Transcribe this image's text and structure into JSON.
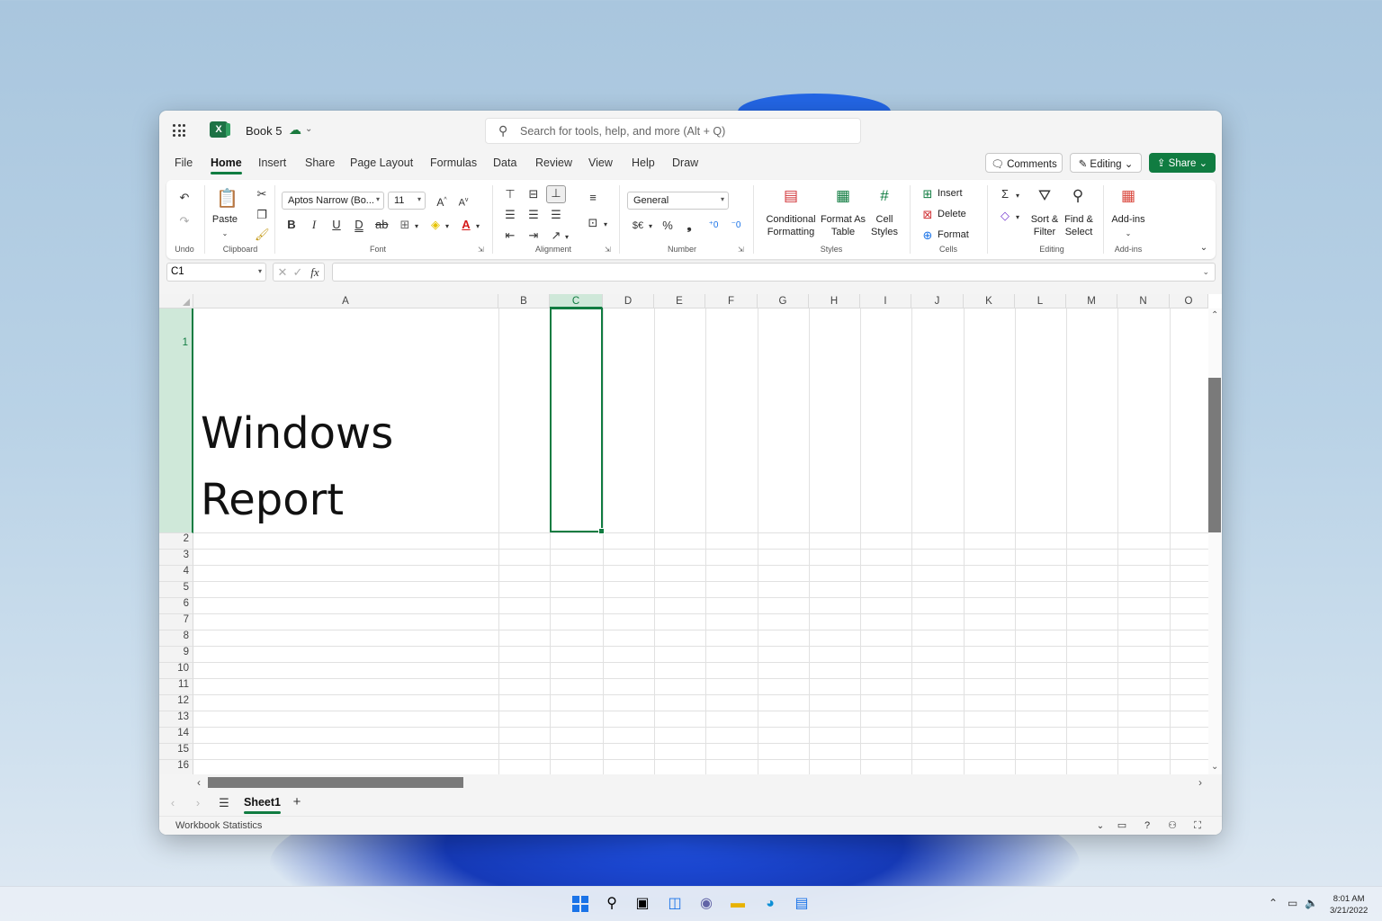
{
  "title_bar": {
    "app_name": "Book 5",
    "search_placeholder": "Search for tools, help, and more (Alt + Q)"
  },
  "menu_tabs": [
    "File",
    "Home",
    "Insert",
    "Share",
    "Page Layout",
    "Formulas",
    "Data",
    "Review",
    "View",
    "Help",
    "Draw"
  ],
  "active_tab": "Home",
  "actions": {
    "comments": "Comments",
    "editing": "Editing",
    "share": "Share"
  },
  "ribbon": {
    "undo_label": "Undo",
    "clipboard": {
      "paste": "Paste",
      "group": "Clipboard"
    },
    "font": {
      "name": "Aptos Narrow (Bo...",
      "size": "11",
      "group": "Font"
    },
    "alignment": {
      "group": "Alignment"
    },
    "number": {
      "format": "General",
      "currency": "$€",
      "percent": "%",
      "comma": "❟",
      "group": "Number"
    },
    "styles": {
      "conditional_1": "Conditional",
      "conditional_2": "Formatting",
      "format_as_1": "Format As",
      "format_as_2": "Table",
      "cell_styles_1": "Cell",
      "cell_styles_2": "Styles",
      "group": "Styles"
    },
    "cells": {
      "insert": "Insert",
      "delete": "Delete",
      "format": "Format",
      "group": "Cells"
    },
    "editing": {
      "sort_1": "Sort &",
      "sort_2": "Filter",
      "find_1": "Find &",
      "find_2": "Select",
      "group": "Editing"
    },
    "addins": {
      "label": "Add-ins",
      "group": "Add-ins"
    }
  },
  "formula_bar": {
    "name_box": "C1",
    "fx": "fx",
    "value": ""
  },
  "grid": {
    "columns": [
      "A",
      "B",
      "C",
      "D",
      "E",
      "F",
      "G",
      "H",
      "I",
      "J",
      "K",
      "L",
      "M",
      "N",
      "O"
    ],
    "selected_column": "C",
    "rows": [
      "1",
      "2",
      "3",
      "4",
      "5",
      "6",
      "7",
      "8",
      "9",
      "10",
      "11",
      "12",
      "13",
      "14",
      "15",
      "16"
    ],
    "cell_a1_line1": "Windows",
    "cell_a1_line2": "Report",
    "active_cell": "C1"
  },
  "sheets": {
    "active": "Sheet1",
    "add": "+"
  },
  "status": {
    "text": "Workbook Statistics"
  },
  "taskbar": {
    "time": "8:01 AM",
    "date": "3/21/2022"
  },
  "colors": {
    "accent": "#107c41",
    "selection_fill": "#cfe8d9"
  }
}
